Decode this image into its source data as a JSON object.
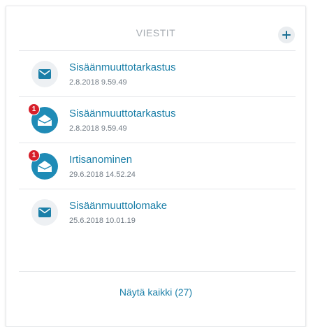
{
  "header": {
    "title": "VIESTIT",
    "add_icon": "plus-icon"
  },
  "messages": [
    {
      "title": "Sisäänmuuttotarkastus",
      "date": "2.8.2018 9.59.49",
      "status": "read",
      "icon": "envelope-closed-icon"
    },
    {
      "title": "Sisäänmuuttotarkastus",
      "date": "2.8.2018 9.59.49",
      "status": "unread",
      "badge": "1",
      "icon": "envelope-open-icon"
    },
    {
      "title": "Irtisanominen",
      "date": "29.6.2018 14.52.24",
      "status": "unread",
      "badge": "1",
      "icon": "envelope-open-icon"
    },
    {
      "title": "Sisäänmuuttolomake",
      "date": "25.6.2018 10.01.19",
      "status": "read",
      "icon": "envelope-closed-icon"
    }
  ],
  "footer": {
    "show_all_label": "Näytä kaikki (27)"
  },
  "colors": {
    "accent": "#1b7fa8",
    "unread_avatar": "#1f8bb6",
    "badge": "#d71f2a",
    "muted_text": "#a4aab0"
  }
}
